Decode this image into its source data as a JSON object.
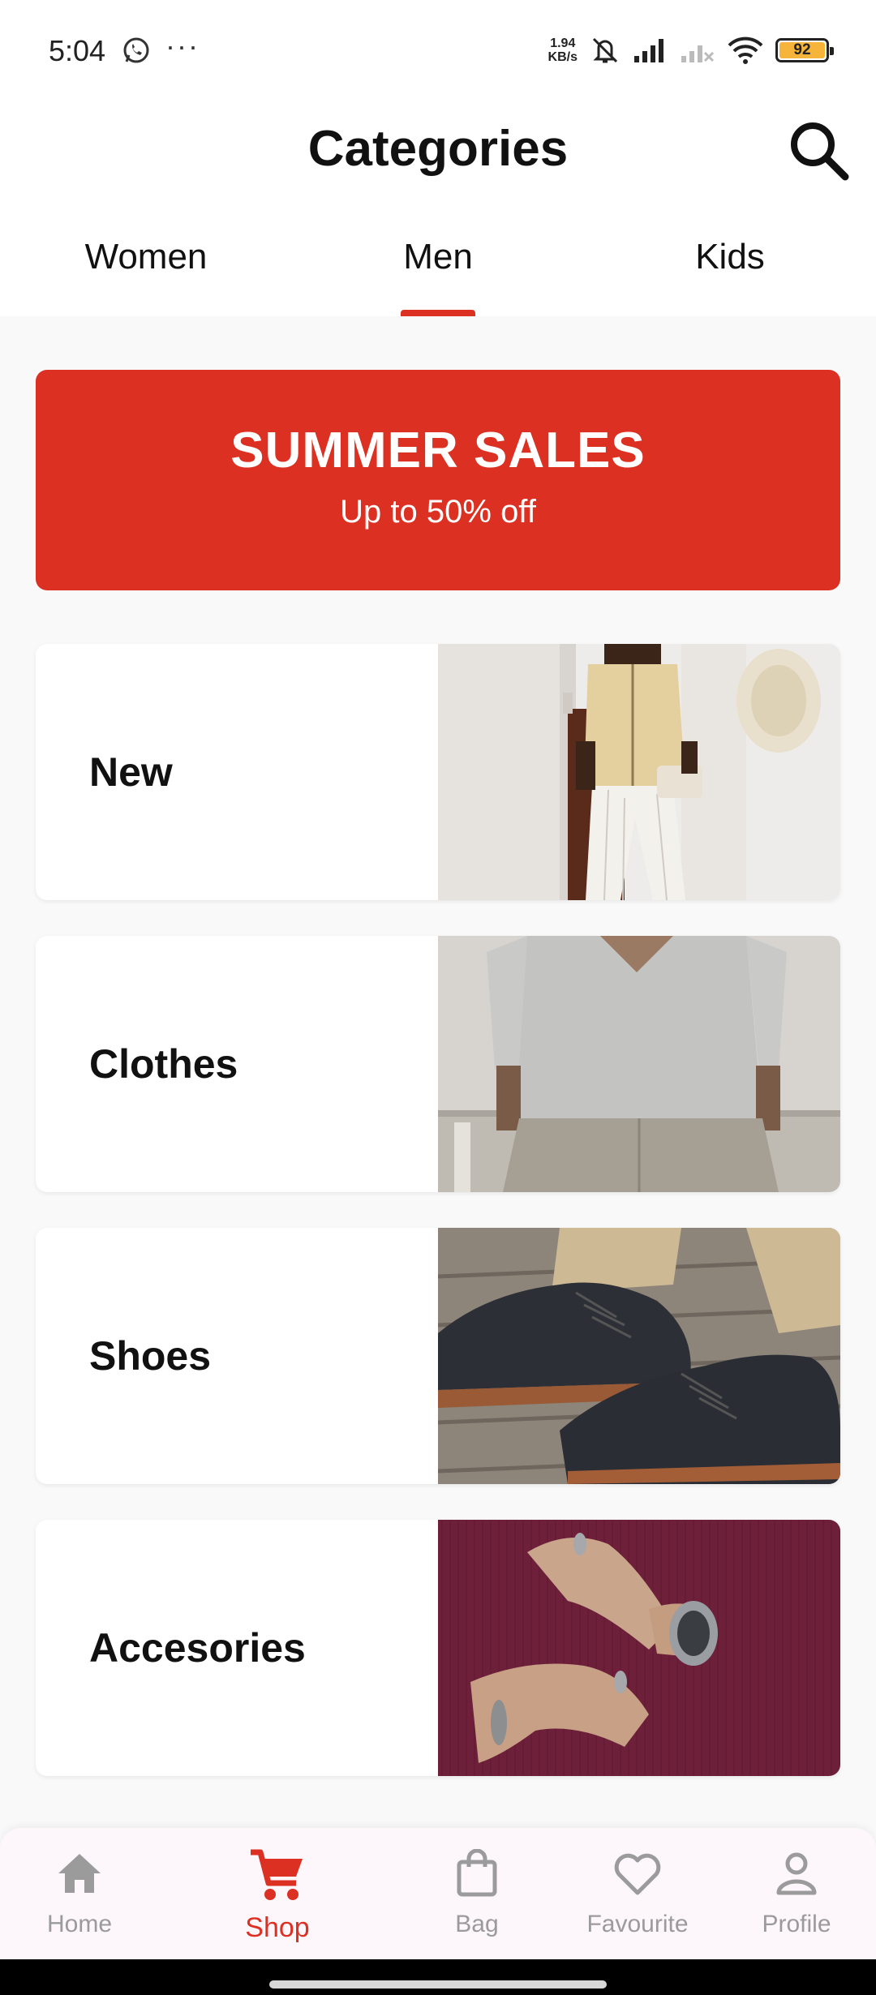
{
  "status_bar": {
    "time": "5:04",
    "net_speed_value": "1.94",
    "net_speed_unit": "KB/s",
    "battery": "92",
    "icons": [
      "whatsapp-icon",
      "more-dots-icon",
      "mute-icon",
      "signal-icon",
      "signal-no-service-icon",
      "wifi-icon",
      "battery-icon"
    ]
  },
  "header": {
    "title": "Categories",
    "search_icon": "search-icon"
  },
  "tabs": [
    {
      "label": "Women",
      "active": false
    },
    {
      "label": "Men",
      "active": true
    },
    {
      "label": "Kids",
      "active": false
    }
  ],
  "banner": {
    "title": "SUMMER SALES",
    "subtitle": "Up to 50% off",
    "color": "#db3022"
  },
  "categories": [
    {
      "label": "New",
      "image": "man in knit shirt and white trousers"
    },
    {
      "label": "Clothes",
      "image": "grey polo shirt and linen trousers"
    },
    {
      "label": "Shoes",
      "image": "dark suede lace-up shoes"
    },
    {
      "label": "Accesories",
      "image": "wristwatch and rings on burgundy sweater"
    }
  ],
  "bottom_nav": [
    {
      "label": "Home",
      "icon": "home-icon",
      "active": false
    },
    {
      "label": "Shop",
      "icon": "cart-icon",
      "active": true
    },
    {
      "label": "Bag",
      "icon": "bag-icon",
      "active": false
    },
    {
      "label": "Favourite",
      "icon": "heart-icon",
      "active": false
    },
    {
      "label": "Profile",
      "icon": "profile-icon",
      "active": false
    }
  ],
  "colors": {
    "accent": "#db3022",
    "inactive_nav": "#9b9b9b",
    "background": "#f9f9f9"
  }
}
